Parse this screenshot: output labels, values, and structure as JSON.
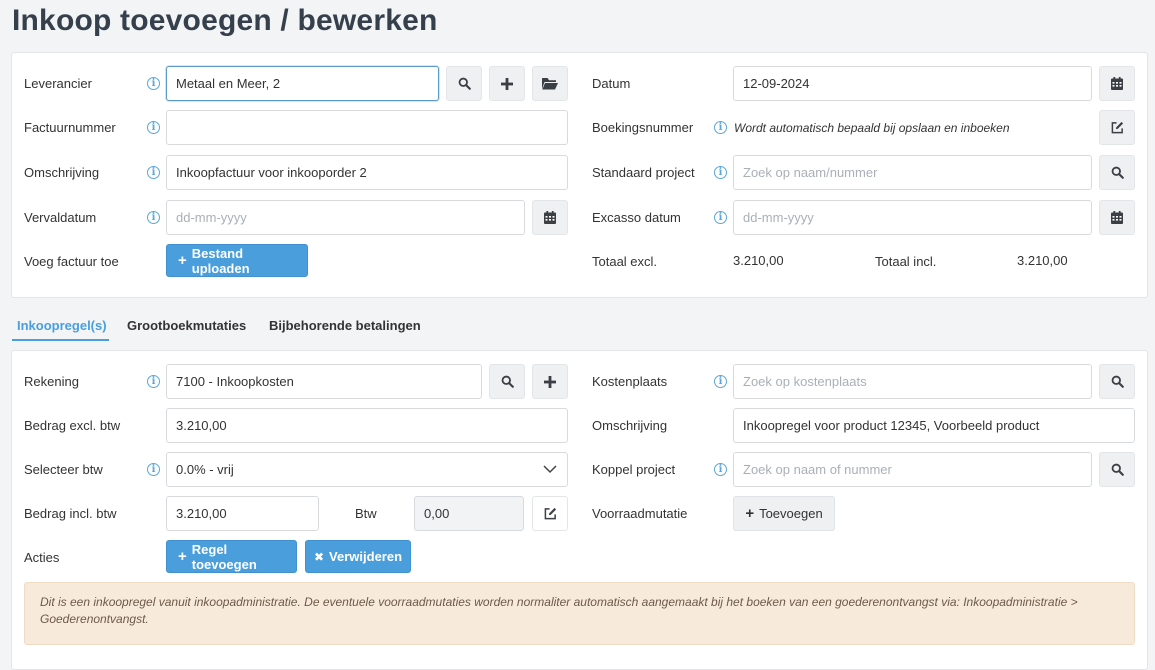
{
  "page": {
    "title": "Inkoop toevoegen / bewerken"
  },
  "header": {
    "leverancier": {
      "label": "Leverancier",
      "value": "Metaal en Meer, 2"
    },
    "factuurnummer": {
      "label": "Factuurnummer",
      "value": ""
    },
    "omschrijving": {
      "label": "Omschrijving",
      "value": "Inkoopfactuur voor inkooporder 2"
    },
    "vervaldatum": {
      "label": "Vervaldatum",
      "placeholder": "dd-mm-yyyy"
    },
    "voeg_factuur": {
      "label": "Voeg factuur toe",
      "button": "Bestand uploaden"
    },
    "datum": {
      "label": "Datum",
      "value": "12-09-2024"
    },
    "boekingsnummer": {
      "label": "Boekingsnummer",
      "note": "Wordt automatisch bepaald bij opslaan en inboeken"
    },
    "standaard_project": {
      "label": "Standaard project",
      "placeholder": "Zoek op naam/nummer"
    },
    "excasso_datum": {
      "label": "Excasso datum",
      "placeholder": "dd-mm-yyyy"
    },
    "totaal_excl": {
      "label": "Totaal excl.",
      "value": "3.210,00"
    },
    "totaal_incl": {
      "label": "Totaal incl.",
      "value": "3.210,00"
    }
  },
  "tabs": [
    {
      "label": "Inkoopregel(s)",
      "active": true
    },
    {
      "label": "Grootboekmutaties",
      "active": false
    },
    {
      "label": "Bijbehorende betalingen",
      "active": false
    }
  ],
  "line": {
    "rekening": {
      "label": "Rekening",
      "value": "7100 - Inkoopkosten"
    },
    "bedrag_excl": {
      "label": "Bedrag excl. btw",
      "value": "3.210,00"
    },
    "selecteer_btw": {
      "label": "Selecteer btw",
      "value": "0.0% - vrij"
    },
    "bedrag_incl": {
      "label": "Bedrag incl. btw",
      "value": "3.210,00"
    },
    "btw": {
      "label": "Btw",
      "value": "0,00"
    },
    "acties": {
      "label": "Acties",
      "add_button": "Regel toevoegen",
      "delete_button": "Verwijderen"
    },
    "kostenplaats": {
      "label": "Kostenplaats",
      "placeholder": "Zoek op kostenplaats"
    },
    "omschrijving": {
      "label": "Omschrijving",
      "value": "Inkoopregel voor product 12345, Voorbeeld product"
    },
    "koppel_project": {
      "label": "Koppel project",
      "placeholder": "Zoek op naam of nummer"
    },
    "voorraadmutatie": {
      "label": "Voorraadmutatie",
      "button": "Toevoegen"
    },
    "alert": "Dit is een inkoopregel vanuit inkoopadministratie. De eventuele voorraadmutaties worden normaliter automatisch aangemaakt bij het boeken van een goederenontvangst via: Inkoopadministratie > Goederenontvangst."
  },
  "info_glyph": "i",
  "colors": {
    "primary": "#4a9edb",
    "title": "#36404c",
    "alert_bg": "#f8eadb"
  }
}
